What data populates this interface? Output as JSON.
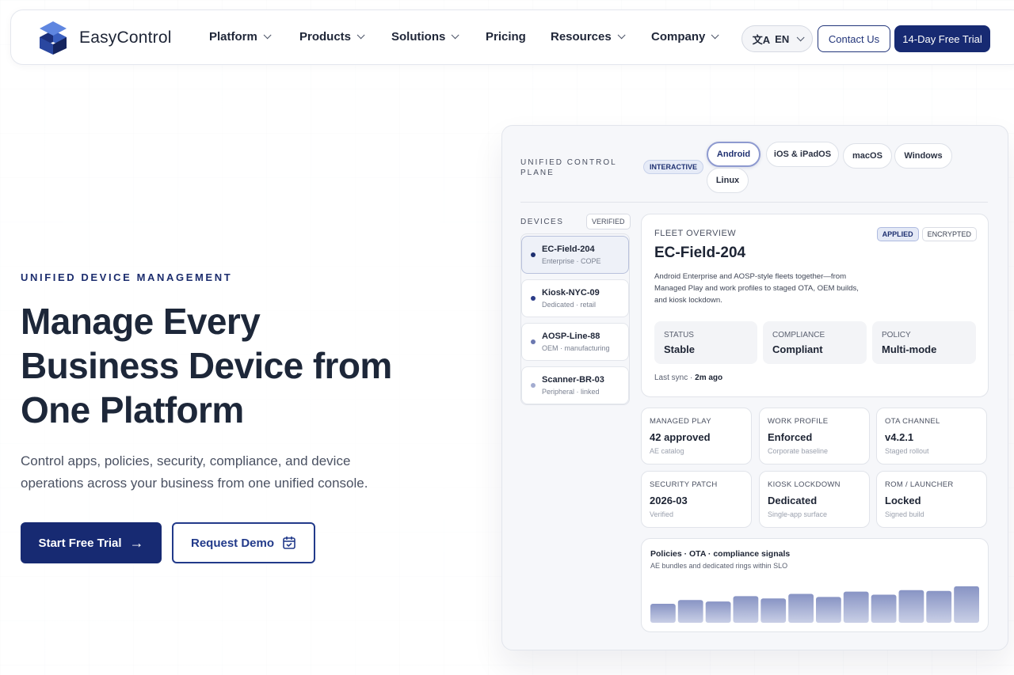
{
  "brand": {
    "name": "EasyControl"
  },
  "nav": {
    "items": [
      {
        "label": "Platform",
        "dropdown": true
      },
      {
        "label": "Products",
        "dropdown": true
      },
      {
        "label": "Solutions",
        "dropdown": true
      },
      {
        "label": "Pricing",
        "dropdown": false
      },
      {
        "label": "Resources",
        "dropdown": true
      },
      {
        "label": "Company",
        "dropdown": true
      }
    ],
    "language": "EN",
    "language_icon": "translate-icon",
    "contact_label": "Contact Us",
    "trial_label": "14-Day Free Trial"
  },
  "hero": {
    "eyebrow": "UNIFIED DEVICE MANAGEMENT",
    "headline": "Manage Every Business Device from One Platform",
    "subtitle": "Control apps, policies, security, compliance, and device operations across your business from one unified console.",
    "primary_cta": "Start Free Trial",
    "secondary_cta": "Request Demo"
  },
  "panel": {
    "title": "UNIFIED CONTROL PLANE",
    "interactive_badge": "INTERACTIVE",
    "platform_tabs": [
      "Android",
      "iOS & iPadOS",
      "macOS",
      "Windows",
      "Linux"
    ],
    "active_tab": "Android",
    "devices_label": "DEVICES",
    "verified_label": "VERIFIED",
    "devices": [
      {
        "name": "EC-Field-204",
        "desc": "Enterprise · COPE",
        "active": true,
        "dot": "#1d2f70"
      },
      {
        "name": "Kiosk-NYC-09",
        "desc": "Dedicated · retail",
        "active": false,
        "dot": "#2b3c88"
      },
      {
        "name": "AOSP-Line-88",
        "desc": "OEM · manufacturing",
        "active": false,
        "dot": "#6b78b0"
      },
      {
        "name": "Scanner-BR-03",
        "desc": "Peripheral · linked",
        "active": false,
        "dot": "#a3acd0"
      }
    ],
    "fleet": {
      "label": "FLEET OVERVIEW",
      "tags": [
        "APPLIED",
        "ENCRYPTED"
      ],
      "device_name": "EC-Field-204",
      "description": "Android Enterprise and AOSP-style fleets together—from Managed Play and work profiles to staged OTA, OEM builds, and kiosk lockdown.",
      "stats": [
        {
          "label": "STATUS",
          "value": "Stable"
        },
        {
          "label": "COMPLIANCE",
          "value": "Compliant"
        },
        {
          "label": "POLICY",
          "value": "Multi-mode"
        }
      ],
      "last_sync_label": "Last sync · ",
      "last_sync_value": "2m ago"
    },
    "cards": [
      {
        "label": "MANAGED PLAY",
        "value": "42 approved",
        "sub": "AE catalog"
      },
      {
        "label": "WORK PROFILE",
        "value": "Enforced",
        "sub": "Corporate baseline"
      },
      {
        "label": "OTA CHANNEL",
        "value": "v4.2.1",
        "sub": "Staged rollout"
      },
      {
        "label": "SECURITY PATCH",
        "value": "2026-03",
        "sub": "Verified"
      },
      {
        "label": "KIOSK LOCKDOWN",
        "value": "Dedicated",
        "sub": "Single-app surface"
      },
      {
        "label": "ROM / LAUNCHER",
        "value": "Locked",
        "sub": "Signed build"
      }
    ],
    "signals": {
      "title": "Policies · OTA · compliance signals",
      "subtitle": "AE bundles and dedicated rings within SLO",
      "bar_levels": [
        0.5,
        0.6,
        0.56,
        0.7,
        0.64,
        0.76,
        0.68,
        0.82,
        0.74,
        0.86,
        0.84,
        0.96
      ]
    }
  },
  "colors": {
    "primary": "#172a72",
    "accent": "#223a8a",
    "text": "#1d2739"
  }
}
